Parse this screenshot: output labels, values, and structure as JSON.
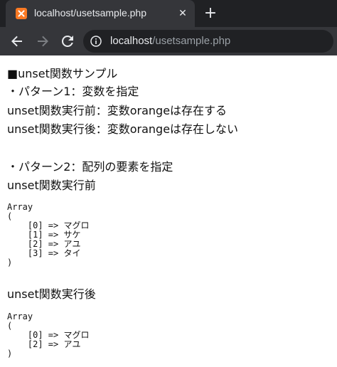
{
  "browser": {
    "tab_title": "localhost/usetsample.php",
    "close_glyph": "✕",
    "new_tab_glyph": "+",
    "url_host": "localhost",
    "url_path": "/usetsample.php",
    "icons": [
      "xampp-favicon",
      "back-arrow-icon",
      "forward-arrow-icon",
      "reload-icon",
      "info-icon"
    ]
  },
  "content": {
    "heading": "■unset関数サンプル",
    "pattern1": "・パターン1：変数を指定",
    "before1": "unset関数実行前：変数orangeは存在する",
    "after1": "unset関数実行後：変数orangeは存在しない",
    "pattern2": "・パターン2：配列の要素を指定",
    "before2_label": "unset関数実行前",
    "before2_dump": "Array\n(\n    [0] => マグロ\n    [1] => サケ\n    [2] => アユ\n    [3] => タイ\n)",
    "after2_label": "unset関数実行後",
    "after2_dump": "Array\n(\n    [0] => マグロ\n    [2] => アユ\n)"
  }
}
